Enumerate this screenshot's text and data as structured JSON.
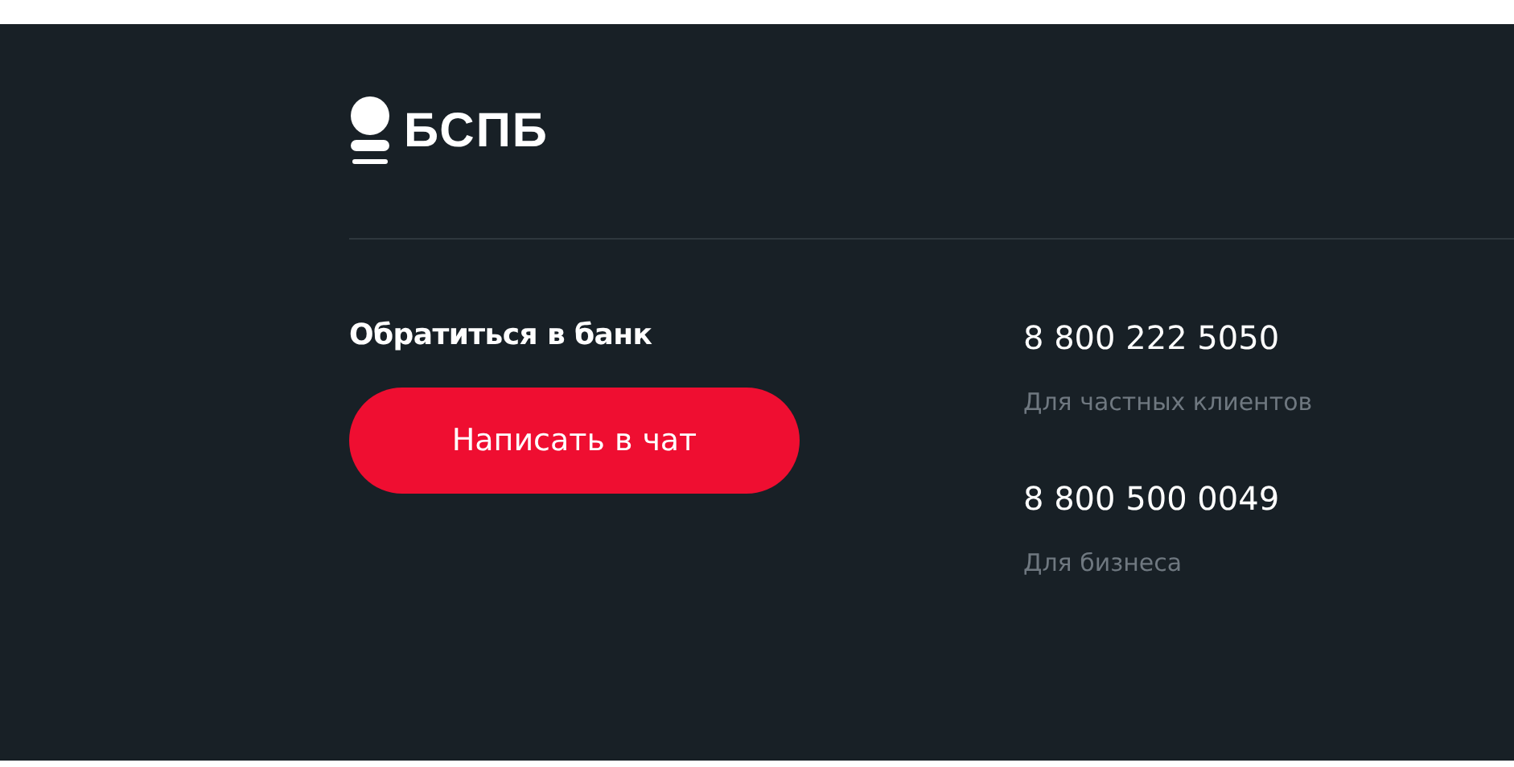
{
  "logo": {
    "text": "БСПБ"
  },
  "contact": {
    "heading": "Обратиться в банк",
    "button": "Написать в чат"
  },
  "phones": [
    {
      "number": "8 800 222 5050",
      "label": "Для частных клиентов"
    },
    {
      "number": "8 800 500 0049",
      "label": "Для бизнеса"
    }
  ]
}
